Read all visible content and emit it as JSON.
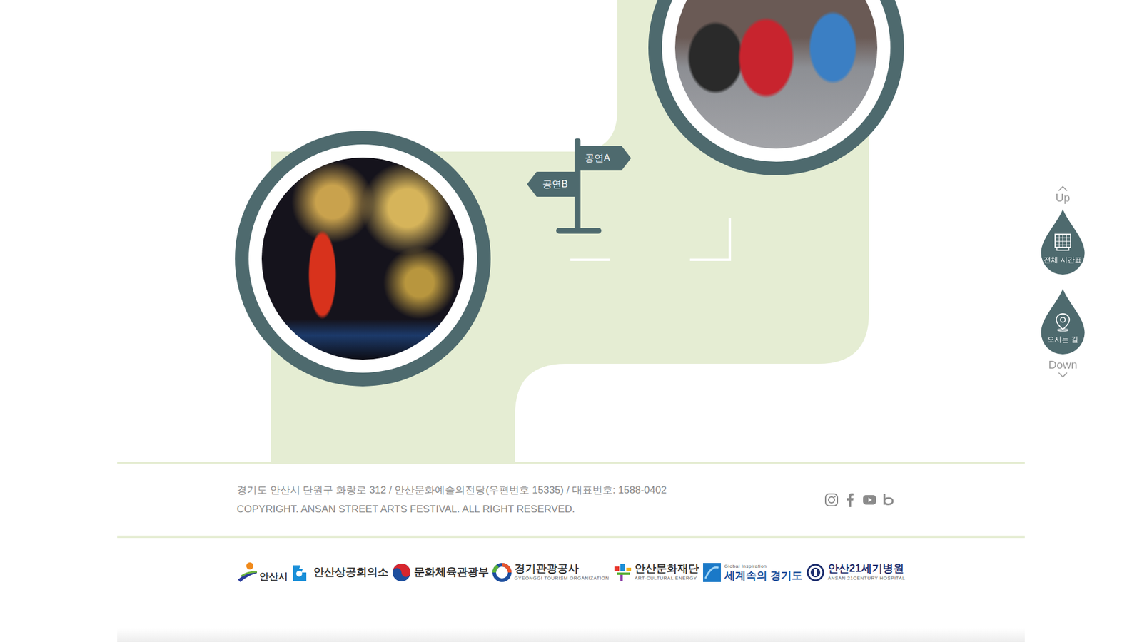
{
  "signs": [
    {
      "label": "공연A"
    },
    {
      "label": "공연B"
    }
  ],
  "side_nav": {
    "up": "Up",
    "items": [
      {
        "label": "전체 시간표",
        "kind": "timetable"
      },
      {
        "label": "오시는 길",
        "kind": "directions"
      }
    ],
    "down": "Down"
  },
  "footer": {
    "address": "경기도 안산시 단원구 화랑로 312 / 안산문화예술의전당(우편번호 15335) / 대표번호: 1588-0402",
    "copyright": "COPYRIGHT. ANSAN STREET ARTS FESTIVAL. ALL RIGHT RESERVED."
  },
  "sponsors": [
    {
      "name": "안산시",
      "kind": "ansan-city"
    },
    {
      "name": "안산상공회의소",
      "kind": "chamber"
    },
    {
      "name": "문화체육관광부",
      "kind": "ministry"
    },
    {
      "name": "경기관광공사",
      "sub": "GYEONGGI TOURISM ORGANIZATION",
      "kind": "tourism"
    },
    {
      "name": "안산문화재단",
      "sub": "ART-CULTURAL ENERGY",
      "kind": "foundation"
    },
    {
      "name": "세계속의 경기도",
      "sub": "Global Inspiration",
      "kind": "gyeonggi"
    },
    {
      "name": "안산21세기병원",
      "sub": "ANSAN 21CENTURY HOSPITAL",
      "kind": "hospital"
    }
  ]
}
